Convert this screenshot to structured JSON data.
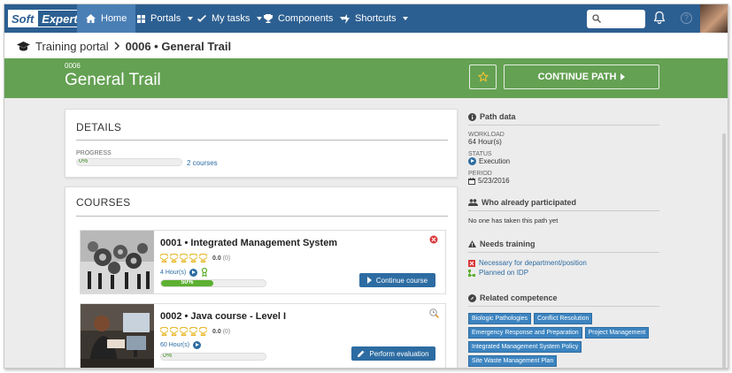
{
  "nav": {
    "logo_left": "Soft",
    "logo_right": "Expert",
    "items": [
      {
        "label": "Home",
        "icon": "home-icon"
      },
      {
        "label": "Portals",
        "icon": "grid-icon"
      },
      {
        "label": "My tasks",
        "icon": "check-icon"
      },
      {
        "label": "Components",
        "icon": "trophy-icon"
      },
      {
        "label": "Shortcuts",
        "icon": "bolt-icon"
      }
    ],
    "help": "?"
  },
  "breadcrumb": {
    "parent": "Training portal",
    "current": "0006 • General Trail"
  },
  "banner": {
    "code": "0006",
    "title": "General Trail",
    "continue_label": "CONTINUE PATH",
    "color": "#64a153"
  },
  "details": {
    "heading": "DETAILS",
    "progress_label": "PROGRESS",
    "progress_text": "0%",
    "progress": 0,
    "courses_link": "2 courses"
  },
  "courses": {
    "heading": "COURSES",
    "items": [
      {
        "title": "0001 • Integrated Management System",
        "rating": "0.0",
        "votes": "(0)",
        "hours": "4 Hour(s)",
        "progress_text": "50%",
        "progress": 0.5,
        "button": "Continue course",
        "status_icon": "error-circle-icon"
      },
      {
        "title": "0002 • Java course - Level I",
        "rating": "0.0",
        "votes": "(0)",
        "hours": "60 Hour(s)",
        "progress_text": "0%",
        "progress": 0,
        "button": "Perform evaluation",
        "status_icon": "clock-search-icon"
      }
    ]
  },
  "path_data": {
    "heading": "Path data",
    "workload_label": "WORKLOAD",
    "workload": "64 Hour(s)",
    "status_label": "STATUS",
    "status": "Execution",
    "period_label": "PERIOD",
    "period": "5/23/2016"
  },
  "participants": {
    "heading": "Who already participated",
    "text": "No one has taken this path yet"
  },
  "needs": {
    "heading": "Needs training",
    "items": [
      "Necessary for department/position",
      "Planned on IDP"
    ]
  },
  "competence": {
    "heading": "Related competence",
    "tags": [
      "Biologic Pathologies",
      "Conflict Resolution",
      "Emergency Response and Preparation",
      "Project Management",
      "Integrated Management System Policy",
      "Site Waste Management Plan"
    ]
  }
}
